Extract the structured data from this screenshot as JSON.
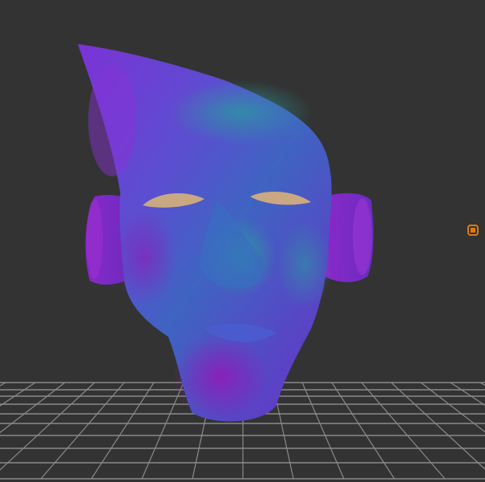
{
  "viewport": {
    "background_color": "#333333",
    "grid_color": "#8a8a8a",
    "model_colors": {
      "purple": "#7a2ed0",
      "magenta": "#8a1fb8",
      "teal": "#2a8a9a",
      "eye": "#c9a882"
    },
    "pivot_icon": {
      "name": "transform-pivot-icon",
      "color": "#e07a10"
    }
  }
}
